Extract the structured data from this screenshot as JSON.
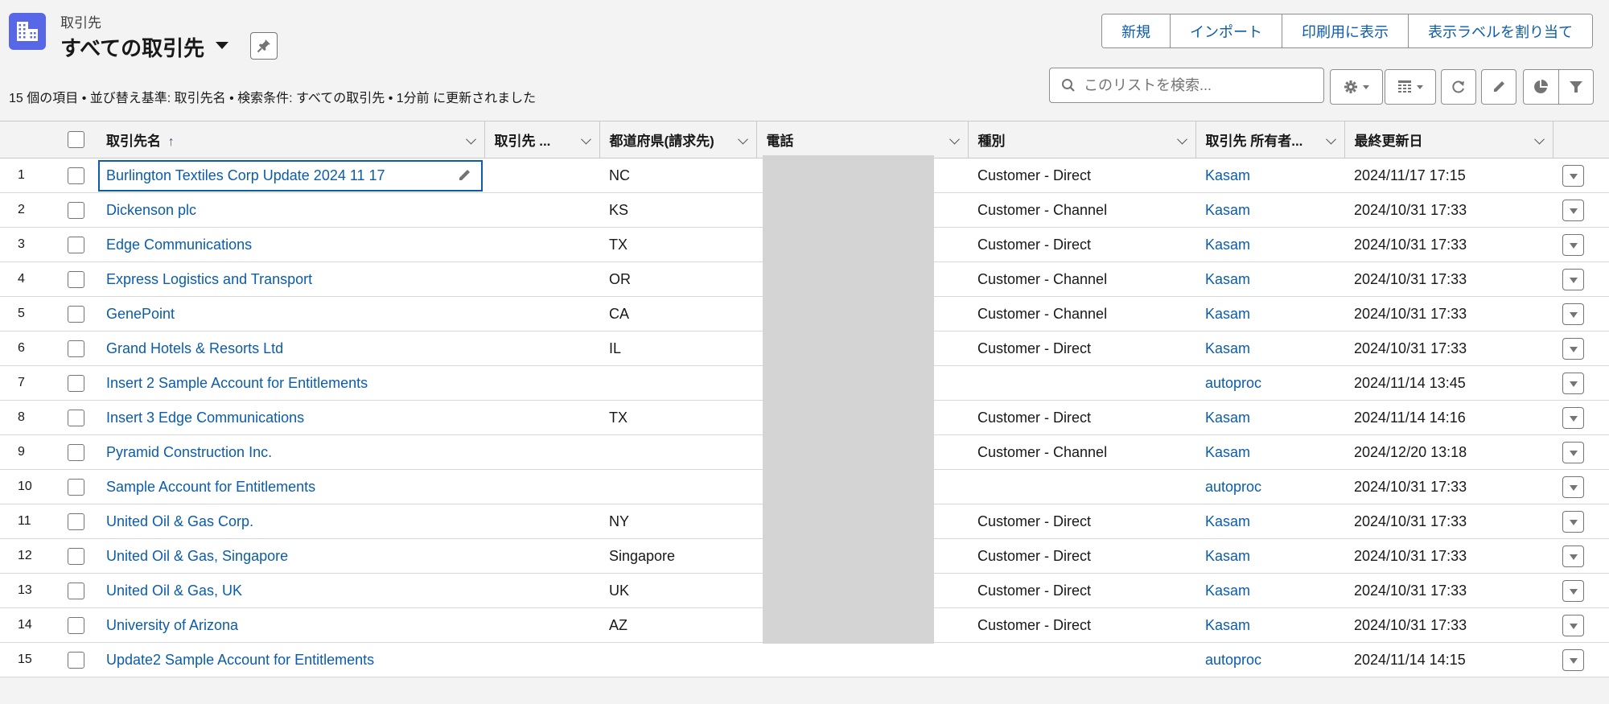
{
  "header": {
    "object_label": "取引先",
    "list_view_title": "すべての取引先",
    "object_icon": "accounts-building-icon",
    "pin_icon": "pin-icon",
    "subtitle": "15 個の項目 • 並び替え基準: 取引先名 • 検索条件: すべての取引先 • 1分前 に更新されました"
  },
  "actions": {
    "new": "新規",
    "import": "インポート",
    "printable_view": "印刷用に表示",
    "assign_label": "表示ラベルを割り当て"
  },
  "toolbar": {
    "search_placeholder": "このリストを検索...",
    "icons": [
      "search-icon",
      "gear-icon",
      "table-view-icon",
      "refresh-icon",
      "pencil-icon",
      "chart-icon",
      "filter-icon"
    ]
  },
  "table": {
    "columns": [
      {
        "label": "取引先名",
        "sorted": "ascending"
      },
      {
        "label": "取引先 ..."
      },
      {
        "label": "都道府県(請求先)"
      },
      {
        "label": "電話"
      },
      {
        "label": "種別"
      },
      {
        "label": "取引先 所有者..."
      },
      {
        "label": "最終更新日"
      }
    ],
    "rows": [
      {
        "num": "1",
        "name": "Burlington Textiles Corp Update 2024 11 17",
        "site": "",
        "state": "NC",
        "phone": "",
        "type": "Customer - Direct",
        "owner": "Kasam",
        "modified": "2024/11/17 17:15"
      },
      {
        "num": "2",
        "name": "Dickenson plc",
        "site": "",
        "state": "KS",
        "phone": "",
        "type": "Customer - Channel",
        "owner": "Kasam",
        "modified": "2024/10/31 17:33"
      },
      {
        "num": "3",
        "name": "Edge Communications",
        "site": "",
        "state": "TX",
        "phone": "",
        "type": "Customer - Direct",
        "owner": "Kasam",
        "modified": "2024/10/31 17:33"
      },
      {
        "num": "4",
        "name": "Express Logistics and Transport",
        "site": "",
        "state": "OR",
        "phone": "",
        "type": "Customer - Channel",
        "owner": "Kasam",
        "modified": "2024/10/31 17:33"
      },
      {
        "num": "5",
        "name": "GenePoint",
        "site": "",
        "state": "CA",
        "phone": "",
        "type": "Customer - Channel",
        "owner": "Kasam",
        "modified": "2024/10/31 17:33"
      },
      {
        "num": "6",
        "name": "Grand Hotels & Resorts Ltd",
        "site": "",
        "state": "IL",
        "phone": "",
        "type": "Customer - Direct",
        "owner": "Kasam",
        "modified": "2024/10/31 17:33"
      },
      {
        "num": "7",
        "name": "Insert 2 Sample Account for Entitlements",
        "site": "",
        "state": "",
        "phone": "",
        "type": "",
        "owner": "autoproc",
        "modified": "2024/11/14 13:45"
      },
      {
        "num": "8",
        "name": "Insert 3 Edge Communications",
        "site": "",
        "state": "TX",
        "phone": "",
        "type": "Customer - Direct",
        "owner": "Kasam",
        "modified": "2024/11/14 14:16"
      },
      {
        "num": "9",
        "name": "Pyramid Construction Inc.",
        "site": "",
        "state": "",
        "phone": "",
        "type": "Customer - Channel",
        "owner": "Kasam",
        "modified": "2024/12/20 13:18"
      },
      {
        "num": "10",
        "name": "Sample Account for Entitlements",
        "site": "",
        "state": "",
        "phone": "",
        "type": "",
        "owner": "autoproc",
        "modified": "2024/10/31 17:33"
      },
      {
        "num": "11",
        "name": "United Oil & Gas Corp.",
        "site": "",
        "state": "NY",
        "phone": "",
        "type": "Customer - Direct",
        "owner": "Kasam",
        "modified": "2024/10/31 17:33"
      },
      {
        "num": "12",
        "name": "United Oil & Gas, Singapore",
        "site": "",
        "state": "Singapore",
        "phone": "",
        "type": "Customer - Direct",
        "owner": "Kasam",
        "modified": "2024/10/31 17:33"
      },
      {
        "num": "13",
        "name": "United Oil & Gas, UK",
        "site": "",
        "state": "UK",
        "phone": "",
        "type": "Customer - Direct",
        "owner": "Kasam",
        "modified": "2024/10/31 17:33"
      },
      {
        "num": "14",
        "name": "University of Arizona",
        "site": "",
        "state": "AZ",
        "phone": "",
        "type": "Customer - Direct",
        "owner": "Kasam",
        "modified": "2024/10/31 17:33"
      },
      {
        "num": "15",
        "name": "Update2 Sample Account for Entitlements",
        "site": "",
        "state": "",
        "phone": "",
        "type": "",
        "owner": "autoproc",
        "modified": "2024/11/14 14:15"
      }
    ]
  },
  "colors": {
    "brand_icon": "#5867e8",
    "link": "#0b5cab",
    "background": "#f3f3f3",
    "redaction": "#d4d4d4"
  }
}
